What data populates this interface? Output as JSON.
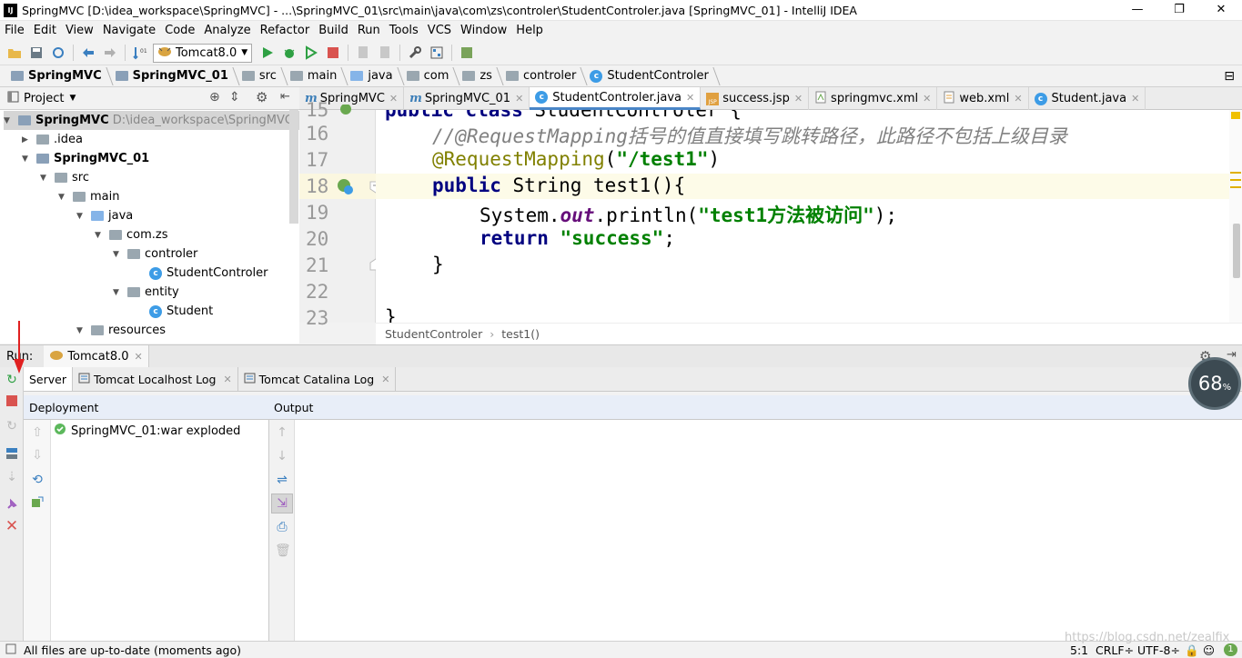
{
  "window": {
    "title": "SpringMVC [D:\\idea_workspace\\SpringMVC] - ...\\SpringMVC_01\\src\\main\\java\\com\\zs\\controler\\StudentControler.java [SpringMVC_01] - IntelliJ IDEA",
    "app_icon": "IJ",
    "minimize": "—",
    "maximize": "❐",
    "close": "✕"
  },
  "menu": [
    "File",
    "Edit",
    "View",
    "Navigate",
    "Code",
    "Analyze",
    "Refactor",
    "Build",
    "Run",
    "Tools",
    "VCS",
    "Window",
    "Help"
  ],
  "toolbar": {
    "run_config": "Tomcat8.0"
  },
  "breadcrumb": [
    "SpringMVC",
    "SpringMVC_01",
    "src",
    "main",
    "java",
    "com",
    "zs",
    "controler",
    "StudentControler"
  ],
  "project_panel": {
    "title": "Project",
    "tree": [
      {
        "label": "SpringMVC",
        "path": "D:\\idea_workspace\\SpringMVC",
        "bold": true
      },
      {
        "label": ".idea"
      },
      {
        "label": "SpringMVC_01",
        "bold": true
      },
      {
        "label": "src"
      },
      {
        "label": "main"
      },
      {
        "label": "java"
      },
      {
        "label": "com.zs"
      },
      {
        "label": "controler"
      },
      {
        "label": "StudentControler"
      },
      {
        "label": "entity"
      },
      {
        "label": "Student"
      },
      {
        "label": "resources"
      }
    ]
  },
  "editor_tabs": [
    {
      "label": "SpringMVC",
      "icon": "m-icon"
    },
    {
      "label": "SpringMVC_01",
      "icon": "m-icon"
    },
    {
      "label": "StudentControler.java",
      "icon": "class-icon",
      "active": true
    },
    {
      "label": "success.jsp",
      "icon": "jsp-icon"
    },
    {
      "label": "springmvc.xml",
      "icon": "xml-icon"
    },
    {
      "label": "web.xml",
      "icon": "xml-icon"
    },
    {
      "label": "Student.java",
      "icon": "class-icon"
    }
  ],
  "editor": {
    "line_numbers": [
      "15",
      "16",
      "17",
      "18",
      "19",
      "20",
      "21",
      "22",
      "23"
    ],
    "line15": {
      "kw1": "public",
      "kw2": "class",
      "name": " StudentControler {"
    },
    "line16": "//@RequestMapping括号的值直接填写跳转路径，此路径不包括上级目录",
    "line17": {
      "annotation": "@RequestMapping",
      "paren_open": "(",
      "string": "\"/test1\"",
      "paren_close": ")"
    },
    "line18": {
      "kw": "public",
      "rest": " String test1(){"
    },
    "line19": {
      "pre": "System.",
      "field": "out",
      "mid": ".println(",
      "string": "\"test1方法被访问\"",
      "post": ");"
    },
    "line20": {
      "kw": "return",
      "string": "\"success\"",
      "post": ";"
    },
    "line21": "}",
    "line23": "}",
    "crumb": [
      "StudentControler",
      "test1()"
    ]
  },
  "run_panel": {
    "label": "Run:",
    "config_tab": "Tomcat8.0",
    "tabs": [
      "Server",
      "Tomcat Localhost Log",
      "Tomcat Catalina Log"
    ],
    "deployment_header": "Deployment",
    "output_header": "Output",
    "deployments": [
      "SpringMVC_01:war exploded"
    ]
  },
  "memory_indicator": {
    "value": "68",
    "unit": "%"
  },
  "status": {
    "message": "All files are up-to-date (moments ago)",
    "position": "5:1",
    "line_sep": "CRLF÷",
    "encoding": "UTF-8÷",
    "notifications": "1"
  },
  "watermark": "https://blog.csdn.net/zealfix",
  "colors": {
    "accent": "#4a86c7",
    "keyword": "#000080",
    "string": "#008000",
    "annotation": "#808000",
    "comment": "#808080",
    "run_green": "#2ea043",
    "stop_red": "#d9534f"
  }
}
